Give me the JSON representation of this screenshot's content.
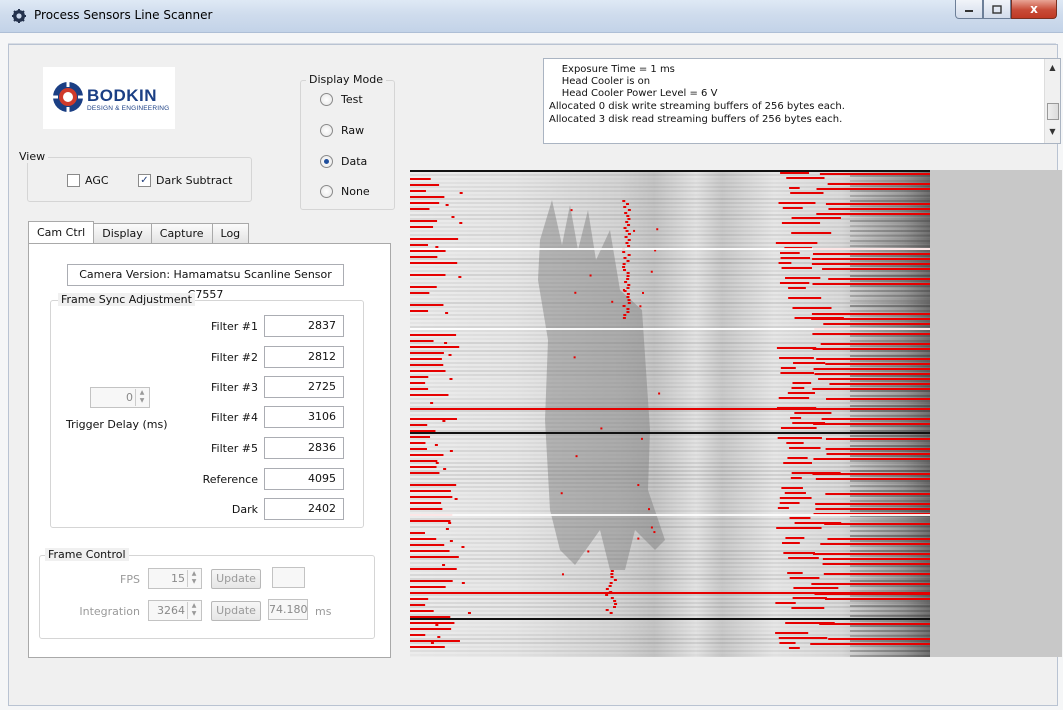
{
  "window": {
    "title": "Process Sensors Line Scanner",
    "min_label": "",
    "max_label": "",
    "close_label": "x"
  },
  "logo": {
    "line1": "BODKIN",
    "line2": "DESIGN & ENGINEERING",
    "color": "#1b3f84"
  },
  "display_mode": {
    "title": "Display Mode",
    "options": [
      {
        "label": "Test",
        "selected": false
      },
      {
        "label": "Raw",
        "selected": false
      },
      {
        "label": "Data",
        "selected": true
      },
      {
        "label": "None",
        "selected": false
      }
    ]
  },
  "view": {
    "title": "View",
    "agc": {
      "label": "AGC",
      "checked": false
    },
    "dark_subtract": {
      "label": "Dark Subtract",
      "checked": true
    }
  },
  "log": {
    "lines": [
      "    Exposure Time = 1 ms",
      "    Head Cooler is on",
      "    Head Cooler Power Level = 6 V",
      "Allocated 0 disk write streaming buffers of 256 bytes each.",
      "Allocated 3 disk read streaming buffers of 256 bytes each."
    ]
  },
  "tabs": [
    {
      "label": "Cam Ctrl",
      "active": true
    },
    {
      "label": "Display",
      "active": false
    },
    {
      "label": "Capture",
      "active": false
    },
    {
      "label": "Log",
      "active": false
    }
  ],
  "cam_ctrl": {
    "camera_version": "Camera Version: Hamamatsu Scanline Sensor C7557",
    "frame_sync": {
      "title": "Frame Sync Adjustment",
      "filters": [
        {
          "label": "Filter #1",
          "value": "2837"
        },
        {
          "label": "Filter #2",
          "value": "2812"
        },
        {
          "label": "Filter #3",
          "value": "2725"
        },
        {
          "label": "Filter #4",
          "value": "3106"
        },
        {
          "label": "Filter #5",
          "value": "2836"
        },
        {
          "label": "Reference",
          "value": "4095"
        },
        {
          "label": "Dark",
          "value": "2402"
        }
      ],
      "trigger_delay": {
        "value": "0",
        "label": "Trigger Delay (ms)"
      }
    },
    "frame_control": {
      "title": "Frame Control",
      "fps": {
        "label": "FPS",
        "value": "15",
        "update_label": "Update",
        "readout": ""
      },
      "integration": {
        "label": "Integration",
        "value": "3264",
        "update_label": "Update",
        "readout": "74.180",
        "unit": "ms"
      }
    }
  },
  "colors": {
    "overlay_red": "#e60000",
    "panel_gray": "#c8c8c8",
    "tab_border": "#a9a9a9"
  }
}
